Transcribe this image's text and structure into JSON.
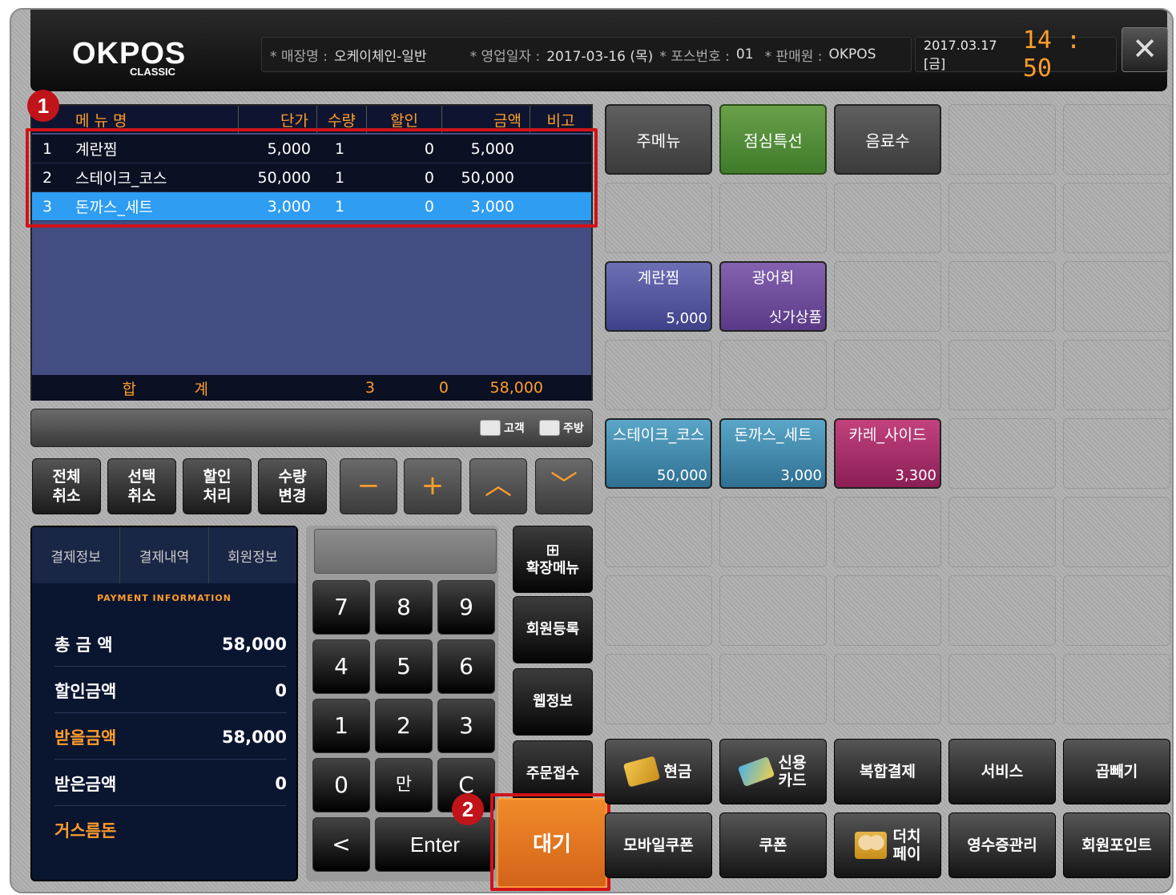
{
  "header": {
    "logo_main": "OKPOS",
    "logo_sub": "CLASSIC",
    "store_label": "* 매장명 :",
    "store_value": "오케이체인-일반",
    "bizdate_label": "* 영업일자 :",
    "bizdate_value": "2017-03-16 (목)",
    "pos_label": "* 포스번호 :",
    "pos_value": "01",
    "seller_label": "* 판매원 :",
    "seller_value": "OKPOS",
    "date": "2017.03.17 [금]",
    "time": "14 : 50",
    "close_label": "✕"
  },
  "grid": {
    "columns": [
      "메 뉴 명",
      "단가",
      "수량",
      "할인",
      "금액",
      "비고"
    ],
    "rows": [
      {
        "no": "1",
        "name": "계란찜",
        "price": "5,000",
        "qty": "1",
        "disc": "0",
        "amt": "5,000"
      },
      {
        "no": "2",
        "name": "스테이크_코스",
        "price": "50,000",
        "qty": "1",
        "disc": "0",
        "amt": "50,000"
      },
      {
        "no": "3",
        "name": "돈까스_세트",
        "price": "3,000",
        "qty": "1",
        "disc": "0",
        "amt": "3,000"
      }
    ],
    "total_label_1": "합",
    "total_label_2": "계",
    "total_qty": "3",
    "total_disc": "0",
    "total_amt": "58,000"
  },
  "annotations": {
    "badge1": "1",
    "badge2": "2"
  },
  "print": {
    "customer": "고객",
    "kitchen": "주방"
  },
  "actions": {
    "cancel_all": "전체\n취소",
    "cancel_sel": "선택\n취소",
    "discount": "할인\n처리",
    "qty_change": "수량\n변경",
    "minus": "−",
    "plus": "+",
    "up": "︿",
    "down": "﹀"
  },
  "payment": {
    "tabs": [
      "결제정보",
      "결제내역",
      "회원정보"
    ],
    "title": "PAYMENT INFORMATION",
    "rows": [
      {
        "label": "총 금 액",
        "value": "58,000"
      },
      {
        "label": "할인금액",
        "value": "0"
      },
      {
        "label": "받을금액",
        "value": "58,000"
      },
      {
        "label": "받은금액",
        "value": "0"
      },
      {
        "label": "거스름돈",
        "value": ""
      }
    ]
  },
  "numpad": {
    "keys": [
      "7",
      "8",
      "9",
      "4",
      "5",
      "6",
      "1",
      "2",
      "3",
      "0",
      "만",
      "C"
    ],
    "back": "<",
    "enter": "Enter"
  },
  "side": {
    "expand_icon": "⊞",
    "expand": "확장메뉴",
    "member_reg": "회원등록",
    "web_info": "웹정보",
    "order_accept": "주문접수",
    "wait": "대기"
  },
  "menu": {
    "categories": [
      "주메뉴",
      "점심특선",
      "음료수"
    ],
    "items": [
      {
        "name": "계란찜",
        "price": "5,000"
      },
      {
        "name": "광어회",
        "price": "싯가상품"
      },
      {
        "name": "스테이크_코스",
        "price": "50,000"
      },
      {
        "name": "돈까스_세트",
        "price": "3,000"
      },
      {
        "name": "카레_사이드",
        "price": "3,300"
      }
    ]
  },
  "paybuttons": {
    "cash": "현금",
    "card": "신용\n카드",
    "complex": "복합결제",
    "service": "서비스",
    "double": "곱빼기",
    "mobile_coupon": "모바일쿠폰",
    "coupon": "쿠폰",
    "dutch": "더치\n페이",
    "receipt": "영수증관리",
    "member_point": "회원포인트"
  },
  "colors": {
    "accent": "#ff9d2c",
    "selected_row": "#2e9df2",
    "highlight_box": "#d0131a",
    "wait_button": "#e87a24"
  }
}
